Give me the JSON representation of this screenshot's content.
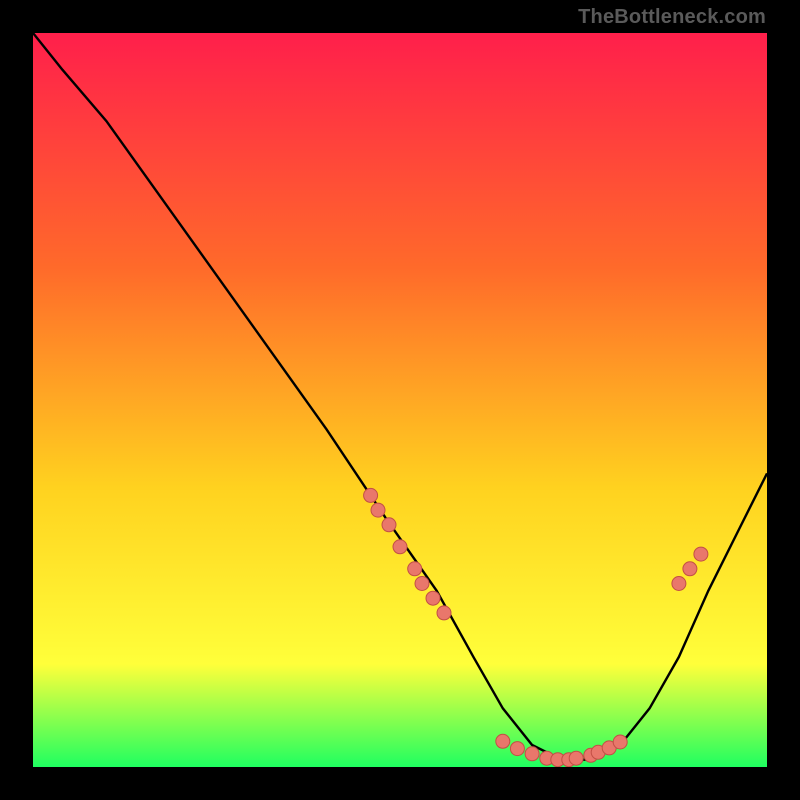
{
  "attribution": "TheBottleneck.com",
  "colors": {
    "gradient_top": "#ff1f4b",
    "gradient_mid1": "#ff6a2a",
    "gradient_mid2": "#ffd21f",
    "gradient_mid3": "#ffff3a",
    "gradient_bottom": "#1fff60",
    "curve": "#000000",
    "dot_fill": "#e9776b",
    "dot_stroke": "#c24f45",
    "frame": "#000000"
  },
  "chart_data": {
    "type": "line",
    "title": "",
    "xlabel": "",
    "ylabel": "",
    "xlim": [
      0,
      100
    ],
    "ylim": [
      0,
      100
    ],
    "curve": {
      "x": [
        0,
        4,
        10,
        20,
        30,
        40,
        48,
        55,
        60,
        64,
        68,
        72,
        76,
        80,
        84,
        88,
        92,
        96,
        100
      ],
      "y": [
        100,
        95,
        88,
        74,
        60,
        46,
        34,
        24,
        15,
        8,
        3,
        1,
        1,
        3,
        8,
        15,
        24,
        32,
        40
      ]
    },
    "series": [
      {
        "name": "marker-cluster-left",
        "x": [
          46,
          47,
          48.5,
          50,
          52,
          53,
          54.5,
          56
        ],
        "y": [
          37,
          35,
          33,
          30,
          27,
          25,
          23,
          21
        ]
      },
      {
        "name": "marker-cluster-bottom",
        "x": [
          64,
          66,
          68,
          70,
          71.5,
          73,
          74,
          76,
          77,
          78.5,
          80
        ],
        "y": [
          3.5,
          2.5,
          1.8,
          1.2,
          1,
          1,
          1.2,
          1.6,
          2,
          2.6,
          3.4
        ]
      },
      {
        "name": "marker-cluster-right",
        "x": [
          88,
          89.5,
          91
        ],
        "y": [
          25,
          27,
          29
        ]
      }
    ],
    "annotations": []
  }
}
